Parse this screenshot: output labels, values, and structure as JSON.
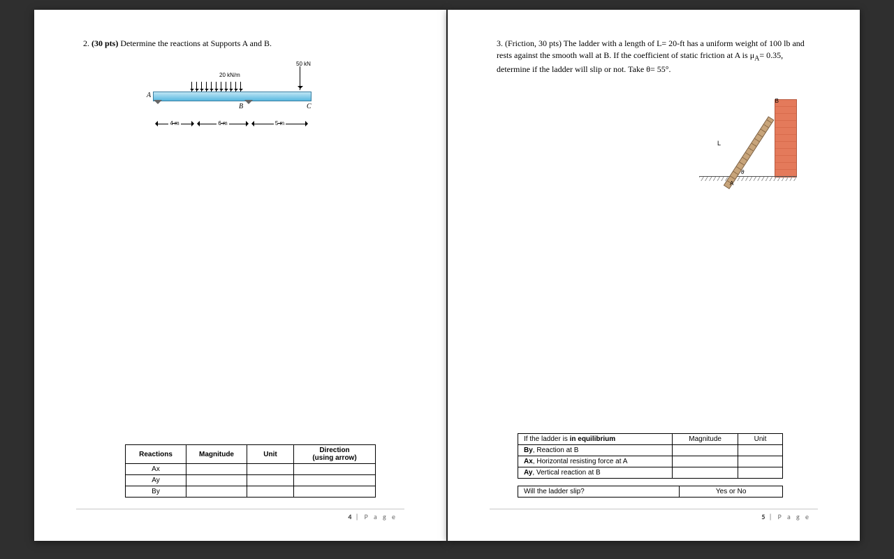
{
  "left": {
    "q_num": "2.",
    "q_pts": "(30 pts)",
    "q_text": "Determine the reactions at Supports A and B.",
    "fig": {
      "point_load": "50 kN",
      "dist_load": "20 kN/m",
      "ptA": "A",
      "ptB": "B",
      "ptC": "C",
      "dim1": "4 m",
      "dim2": "6 m",
      "dim3": "5 m"
    },
    "table": {
      "h1": "Reactions",
      "h2": "Magnitude",
      "h3": "Unit",
      "h4a": "Direction",
      "h4b": "(using arrow)",
      "r1": "Ax",
      "r2": "Ay",
      "r3": "By"
    },
    "footer_num": "4",
    "footer_lbl": " | P a g e"
  },
  "right": {
    "q_num": "3.",
    "q_pts": "(Friction, 30 pts)",
    "q_text1": "The ladder with a length of L= 20-ft has a uniform weight of 100 lb and rests against the smooth wall at B.  If the coefficient of static friction at A is μ",
    "q_sub": "A",
    "q_text2": "= 0.35, determine if the ladder will slip or not.  Take θ= 55°.",
    "fig": {
      "L": "L",
      "A": "A",
      "B": "B",
      "theta": "θ"
    },
    "table1": {
      "h1a": "If the ladder is ",
      "h1b": "in equilibrium",
      "h2": "Magnitude",
      "h3": "Unit",
      "r1a": "By",
      "r1b": ", Reaction at B",
      "r2a": "Ax",
      "r2b": ", Horizontal  resisting force at A",
      "r3a": "Ay",
      "r3b": ", Vertical reaction at B"
    },
    "table2": {
      "q": "Will the ladder slip?",
      "a": "Yes or No"
    },
    "footer_num": "5",
    "footer_lbl": " | P a g e"
  }
}
